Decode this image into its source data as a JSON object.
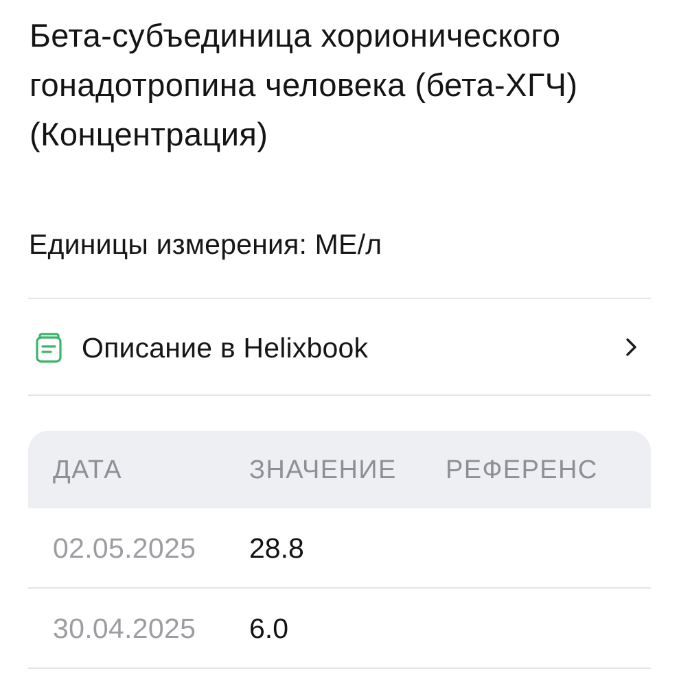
{
  "title": "Бета-субъединица хорионического гонадотропина человека (бета-ХГЧ) (Концентрация)",
  "units": "Единицы измерения: МЕ/л",
  "helixbook": {
    "label": "Описание в Helixbook",
    "icon": "book-icon",
    "icon_color": "#3bb56c",
    "chevron": "chevron-right-icon"
  },
  "table": {
    "headers": {
      "date": "ДАТА",
      "value": "ЗНАЧЕНИЕ",
      "reference": "РЕФЕРЕНС"
    },
    "rows": [
      {
        "date": "02.05.2025",
        "value": "28.8",
        "reference": ""
      },
      {
        "date": "30.04.2025",
        "value": "6.0",
        "reference": ""
      }
    ]
  },
  "colors": {
    "text": "#141414",
    "muted": "#8e8f95",
    "divider": "#e3e4e8",
    "table_header_bg": "#eeeff3",
    "accent": "#3bb56c"
  }
}
